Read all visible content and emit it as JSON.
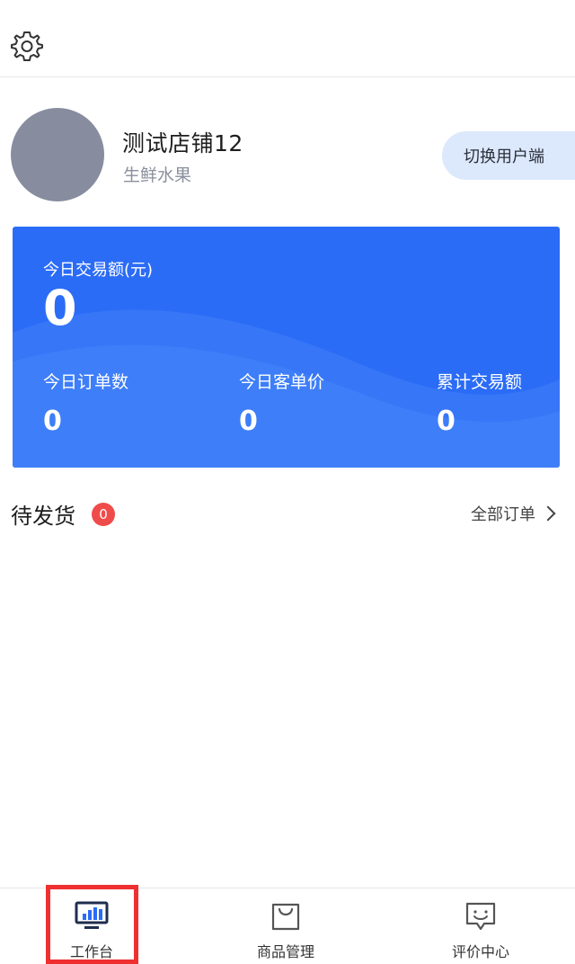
{
  "header": {
    "settings_icon": "gear-icon"
  },
  "profile": {
    "shop_name": "测试店铺12",
    "category": "生鲜水果",
    "switch_label": "切换用户端"
  },
  "stats": {
    "main_label": "今日交易额(元)",
    "main_value": "0",
    "items": [
      {
        "label": "今日订单数",
        "value": "0"
      },
      {
        "label": "今日客单价",
        "value": "0"
      },
      {
        "label": "累计交易额",
        "value": "0"
      }
    ]
  },
  "pending": {
    "title": "待发货",
    "badge": "0",
    "all_orders": "全部订单"
  },
  "tabbar": {
    "items": [
      {
        "label": "工作台",
        "icon": "monitor-chart-icon",
        "active": true
      },
      {
        "label": "商品管理",
        "icon": "shopping-bag-icon",
        "active": false
      },
      {
        "label": "评价中心",
        "icon": "chat-smile-icon",
        "active": false
      }
    ]
  },
  "colors": {
    "primary": "#2b6cf6",
    "badge": "#f04b4b",
    "switch_bg": "#dce8fb",
    "highlight": "#ef3030"
  }
}
